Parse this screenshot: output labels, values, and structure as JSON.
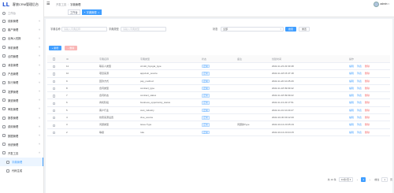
{
  "app": {
    "logo": "LL",
    "title": "客旅CRM管理后台"
  },
  "sidebar": {
    "dashboard": "工作台",
    "items": [
      {
        "label": "线索管理",
        "icon": "user-icon"
      },
      {
        "label": "客户管理",
        "icon": "users-icon"
      },
      {
        "label": "出海入驻报",
        "icon": "flag-icon"
      },
      {
        "label": "商机管理",
        "icon": "briefcase-icon"
      },
      {
        "label": "合同管理",
        "icon": "file-icon"
      },
      {
        "label": "消息管理",
        "icon": "message-icon"
      },
      {
        "label": "产品管理",
        "icon": "box-icon"
      },
      {
        "label": "执行管理",
        "icon": "check-icon"
      },
      {
        "label": "发票管理",
        "icon": "receipt-icon"
      },
      {
        "label": "渠道管理",
        "icon": "channel-icon"
      },
      {
        "label": "审批管理",
        "icon": "approval-icon"
      },
      {
        "label": "报表管理",
        "icon": "chart-icon"
      },
      {
        "label": "费用管理",
        "icon": "money-icon"
      },
      {
        "label": "数据管理",
        "icon": "database-icon"
      },
      {
        "label": "系统管理",
        "icon": "gear-icon"
      },
      {
        "label": "开发工具",
        "icon": "tool-icon"
      }
    ],
    "children": [
      {
        "label": "字典管理"
      },
      {
        "label": "代码生成"
      }
    ]
  },
  "topbar": {
    "crumbs": [
      "开发工具",
      "字典管理"
    ],
    "user": "admin"
  },
  "tabs": [
    {
      "label": "工作台"
    },
    {
      "label": "字典管理"
    }
  ],
  "search": {
    "name_label": "字典名称",
    "name_placeholder": "请输入字典名称",
    "type_label": "字典类型",
    "type_placeholder": "请输入字典类型",
    "status_label": "状态",
    "status_value": "全部",
    "search_btn": "搜索",
    "reset_btn": "重置"
  },
  "toolbar": {
    "add": "+ 新增",
    "delete": "− 删除"
  },
  "table": {
    "columns": [
      "ID",
      "字典名称",
      "字典类型",
      "状态",
      "备注",
      "创建时间",
      "操作"
    ],
    "ops": [
      "编辑",
      "列表",
      "删除"
    ],
    "rows": [
      {
        "id": "11",
        "name": "联系人类型",
        "type": "crmkit_hiyogai_type",
        "status": "正常",
        "remark": "",
        "created": "2022-11-23 22:33:48"
      },
      {
        "id": "10",
        "name": "项目来源",
        "type": "appviuin_source",
        "status": "正常",
        "remark": "",
        "created": "2022-11-18 15:47:18"
      },
      {
        "id": "9",
        "name": "回款方式",
        "type": "pay_method",
        "status": "正常",
        "remark": "",
        "created": "2022-11-20 10:25:29"
      },
      {
        "id": "8",
        "name": "合同类型",
        "type": "contract_type",
        "status": "正常",
        "remark": "",
        "created": "2022-11-18 09:09:42"
      },
      {
        "id": "7",
        "name": "合同状态",
        "type": "contract_status",
        "status": "正常",
        "remark": "",
        "created": "2022-11-18 09:09:22"
      },
      {
        "id": "6",
        "name": "商机阶段",
        "type": "business_opportunity_status",
        "status": "正常",
        "remark": "",
        "created": "2022-11-13 22:17:51"
      },
      {
        "id": "5",
        "name": "客户行业",
        "type": "cust_industry",
        "status": "正常",
        "remark": "",
        "created": "2022-11-01 10:23:27"
      },
      {
        "id": "4",
        "name": "线索来源设置",
        "type": "clue_source",
        "status": "正常",
        "remark": "",
        "created": "2022-10-30 09:12:40"
      },
      {
        "id": "3",
        "name": "问题类型",
        "type": "issue.Type",
        "status": "正常",
        "remark": "问题的Type",
        "created": "2022-10-13 23:25:19"
      },
      {
        "id": "2",
        "name": "等级",
        "type": "rule",
        "status": "正常",
        "remark": "",
        "created": "2022-10-13 23:24:15"
      }
    ]
  },
  "pager": {
    "total": "共 10 条",
    "size": "10条/页",
    "prev": "‹",
    "page": "1",
    "next": "›",
    "goto_label": "前往",
    "goto_value": "1",
    "goto_suffix": "页"
  }
}
